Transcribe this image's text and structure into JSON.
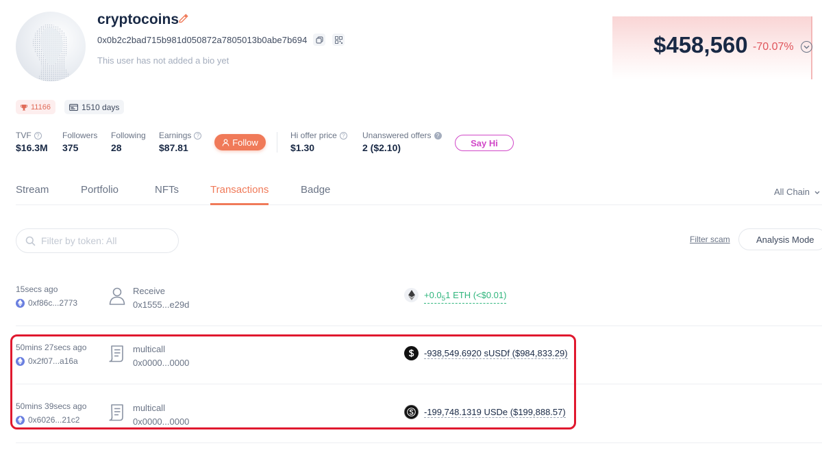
{
  "profile": {
    "username": "cryptocoins",
    "address": "0x0b2c2bad715b981d050872a7805013b0abe7b694",
    "bio": "This user has not added a bio yet",
    "rank_badge": "11166",
    "days_badge": "1510 days"
  },
  "networth": {
    "value": "$458,560",
    "change": "-70.07%",
    "accent_color": "#e0555b"
  },
  "stats": {
    "tvf": {
      "label": "TVF",
      "value": "$16.3M"
    },
    "followers": {
      "label": "Followers",
      "value": "375"
    },
    "following": {
      "label": "Following",
      "value": "28"
    },
    "earnings": {
      "label": "Earnings",
      "value": "$87.81"
    },
    "follow_button": "Follow",
    "hi_offer_price": {
      "label": "Hi offer price",
      "value": "$1.30"
    },
    "unanswered_offers": {
      "label": "Unanswered offers",
      "value": "2 ($2.10)"
    },
    "say_hi_button": "Say Hi"
  },
  "tabs": [
    {
      "label": "Stream"
    },
    {
      "label": "Portfolio"
    },
    {
      "label": "NFTs"
    },
    {
      "label": "Transactions",
      "active": true
    },
    {
      "label": "Badge"
    }
  ],
  "chain_select": "All Chain",
  "filter": {
    "placeholder": "Filter by token: All",
    "filter_scam": "Filter scam",
    "analysis_mode": "Analysis Mode"
  },
  "transactions": [
    {
      "time": "15secs ago",
      "hash": "0xf86c...2773",
      "type": "Receive",
      "target": "0x1555...e29d",
      "icon": "user-icon",
      "token_icon": "eth-icon",
      "amount_prefix": "+0.0",
      "amount_sub": "5",
      "amount_suffix": "1 ETH (<$0.01)",
      "direction": "in"
    },
    {
      "time": "50mins 27secs ago",
      "hash": "0x2f07...a16a",
      "type": "multicall",
      "target": "0x0000...0000",
      "icon": "contract-icon",
      "token_icon": "susdf-icon",
      "amount": "-938,549.6920 sUSDf ($984,833.29)",
      "direction": "out"
    },
    {
      "time": "50mins 39secs ago",
      "hash": "0x6026...21c2",
      "type": "multicall",
      "target": "0x0000...0000",
      "icon": "contract-icon",
      "token_icon": "usde-icon",
      "amount": "-199,748.1319 USDe ($199,888.57)",
      "direction": "out"
    }
  ],
  "colors": {
    "accent": "#f07a59",
    "positive": "#2fb57c",
    "say_hi": "#d147c8",
    "highlight": "#e0182e"
  }
}
